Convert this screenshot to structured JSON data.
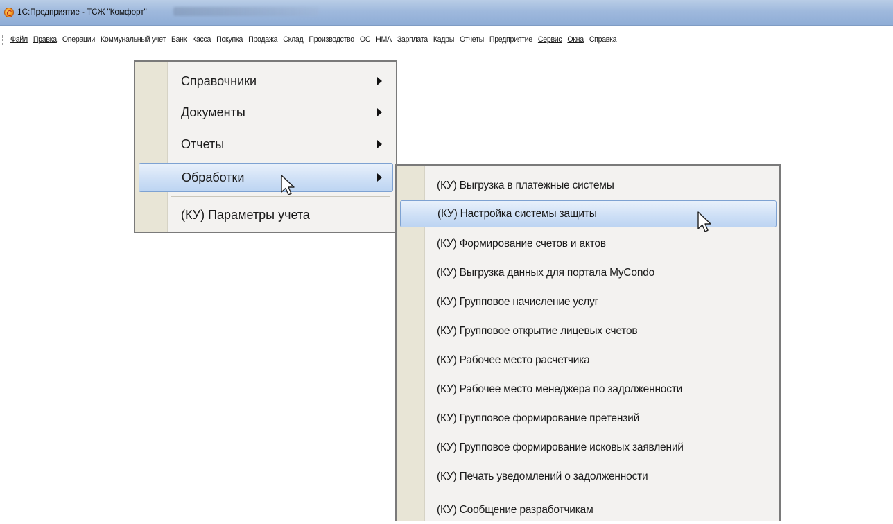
{
  "window": {
    "title": "1С:Предприятие - ТСЖ \"Комфорт\""
  },
  "menubar": {
    "items": [
      {
        "label": "Файл",
        "underline": true
      },
      {
        "label": "Правка",
        "underline": true
      },
      {
        "label": "Операции",
        "underline": false
      },
      {
        "label": "Коммунальный учет",
        "underline": false
      },
      {
        "label": "Банк",
        "underline": false
      },
      {
        "label": "Касса",
        "underline": false
      },
      {
        "label": "Покупка",
        "underline": false
      },
      {
        "label": "Продажа",
        "underline": false
      },
      {
        "label": "Склад",
        "underline": false
      },
      {
        "label": "Производство",
        "underline": false
      },
      {
        "label": "ОС",
        "underline": false
      },
      {
        "label": "НМА",
        "underline": false
      },
      {
        "label": "Зарплата",
        "underline": false
      },
      {
        "label": "Кадры",
        "underline": false
      },
      {
        "label": "Отчеты",
        "underline": false
      },
      {
        "label": "Предприятие",
        "underline": false
      },
      {
        "label": "Сервис",
        "underline": true
      },
      {
        "label": "Окна",
        "underline": true
      },
      {
        "label": "Справка",
        "underline": false
      }
    ]
  },
  "main_menu": {
    "items": [
      {
        "label": "Справочники",
        "submenu": true
      },
      {
        "label": "Документы",
        "submenu": true
      },
      {
        "label": "Отчеты",
        "submenu": true
      },
      {
        "label": "Обработки",
        "submenu": true,
        "highlighted": true
      },
      {
        "label": "(КУ) Параметры учета",
        "submenu": false
      }
    ]
  },
  "sub_menu": {
    "items": [
      {
        "label": "(КУ) Выгрузка в платежные системы"
      },
      {
        "label": "(КУ) Настройка системы защиты",
        "highlighted": true
      },
      {
        "label": "(КУ) Формирование счетов и актов"
      },
      {
        "label": "(КУ) Выгрузка данных для портала MyCondo"
      },
      {
        "label": "(КУ) Групповое начисление услуг"
      },
      {
        "label": "(КУ) Групповое открытие лицевых счетов"
      },
      {
        "label": "(КУ) Рабочее место расчетчика"
      },
      {
        "label": "(КУ) Рабочее место менеджера по задолженности"
      },
      {
        "label": "(КУ) Групповое формирование претензий"
      },
      {
        "label": "(КУ) Групповое формирование исковых заявлений"
      },
      {
        "label": "(КУ) Печать уведомлений о задолженности"
      },
      {
        "label": "(КУ) Сообщение разработчикам"
      }
    ]
  },
  "icons": {
    "app": "1c-app-icon",
    "submenu_arrow": "submenu-arrow-icon",
    "cursor": "mouse-pointer-icon"
  },
  "colors": {
    "titlebar": "#9fb9dd",
    "menu_bg": "#f3f2f0",
    "gutter": "#e8e5d6",
    "highlight": "#cfe0f6",
    "highlight_border": "#7ea2d2"
  }
}
